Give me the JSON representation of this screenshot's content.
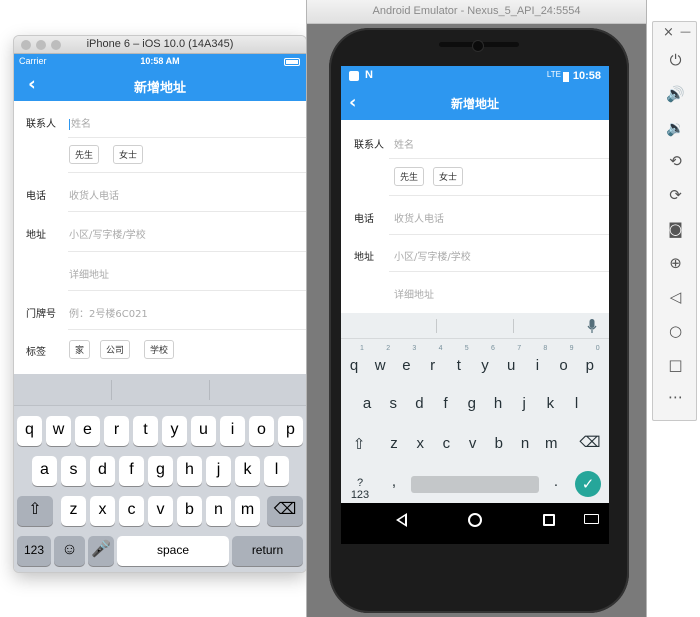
{
  "ios": {
    "window_title": "iPhone 6 – iOS 10.0 (14A345)",
    "carrier": "Carrier",
    "time": "10:58 AM",
    "back_icon": "chevron-left-icon",
    "nav_title": "新增地址",
    "contact_label": "联系人",
    "name_placeholder": "姓名",
    "gender_options": [
      "先生",
      "女士"
    ],
    "phone_label": "电话",
    "phone_placeholder": "收货人电话",
    "address_label": "地址",
    "area_placeholder": "小区/写字楼/学校",
    "detail_placeholder": "详细地址",
    "doorplate_label": "门牌号",
    "doorplate_placeholder": "例：2号楼6C021",
    "tag_label": "标签",
    "tags": [
      "家",
      "公司",
      "学校"
    ],
    "keyboard": {
      "row1": [
        "q",
        "w",
        "e",
        "r",
        "t",
        "y",
        "u",
        "i",
        "o",
        "p"
      ],
      "row2": [
        "a",
        "s",
        "d",
        "f",
        "g",
        "h",
        "j",
        "k",
        "l"
      ],
      "row3": [
        "z",
        "x",
        "c",
        "v",
        "b",
        "n",
        "m"
      ],
      "shift_icon": "shift-icon",
      "delete_icon": "backspace-icon",
      "numbers_label": "123",
      "emoji_icon": "emoji-icon",
      "mic_icon": "microphone-icon",
      "space_label": "space",
      "return_label": "return"
    }
  },
  "android": {
    "window_title": "Android Emulator - Nexus_5_API_24:5554",
    "time": "10:58",
    "signal": "LTE",
    "back_icon": "arrow-left-icon",
    "nav_title": "新增地址",
    "contact_label": "联系人",
    "name_placeholder": "姓名",
    "gender_options": [
      "先生",
      "女士"
    ],
    "phone_label": "电话",
    "phone_placeholder": "收货人电话",
    "address_label": "地址",
    "area_placeholder": "小区/写字楼/学校",
    "detail_placeholder": "详细地址",
    "keyboard": {
      "row1": [
        "q",
        "w",
        "e",
        "r",
        "t",
        "y",
        "u",
        "i",
        "o",
        "p"
      ],
      "row1_hints": [
        "1",
        "2",
        "3",
        "4",
        "5",
        "6",
        "7",
        "8",
        "9",
        "0"
      ],
      "row2": [
        "a",
        "s",
        "d",
        "f",
        "g",
        "h",
        "j",
        "k",
        "l"
      ],
      "row3": [
        "z",
        "x",
        "c",
        "v",
        "b",
        "n",
        "m"
      ],
      "shift_icon": "shift-icon",
      "delete_icon": "backspace-icon",
      "symbols_label": "?123",
      "comma": ",",
      "period": ".",
      "mic_icon": "microphone-icon",
      "enter_icon": "check-icon"
    },
    "sysnav": [
      "back-icon",
      "home-icon",
      "recents-icon",
      "keyboard-icon"
    ]
  },
  "toolbar": {
    "icons": [
      "close-icon",
      "minimize-icon",
      "power-icon",
      "volume-up-icon",
      "volume-down-icon",
      "rotate-left-icon",
      "rotate-right-icon",
      "camera-icon",
      "zoom-icon",
      "back-icon",
      "home-icon",
      "overview-icon",
      "more-icon"
    ],
    "close_glyph": "×",
    "minimize_glyph": "—"
  },
  "colors": {
    "brand_blue": "#2d97f0",
    "android_enter": "#26a69a"
  }
}
